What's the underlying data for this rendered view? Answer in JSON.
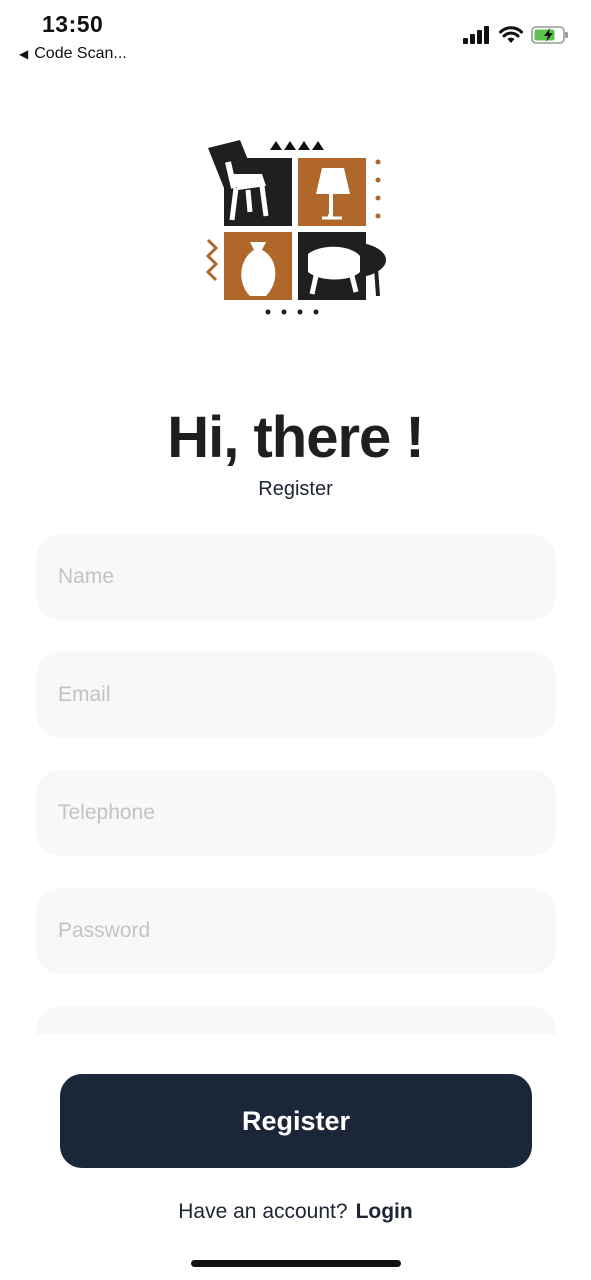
{
  "status_bar": {
    "time": "13:50",
    "back_label": "Code Scan...",
    "icons": [
      "back-arrow-icon",
      "signal-icon",
      "wifi-icon",
      "battery-charging-icon"
    ]
  },
  "header": {
    "title": "Hi, there !",
    "subtitle": "Register"
  },
  "form": {
    "fields": [
      {
        "placeholder": "Name",
        "value": ""
      },
      {
        "placeholder": "Email",
        "value": ""
      },
      {
        "placeholder": "Telephone",
        "value": ""
      },
      {
        "placeholder": "Password",
        "value": ""
      },
      {
        "placeholder": "",
        "value": ""
      }
    ]
  },
  "actions": {
    "register_label": "Register"
  },
  "footer": {
    "prompt": "Have an account?",
    "login_label": "Login"
  },
  "colors": {
    "brand_brown": "#b0682a",
    "dark": "#1b2638",
    "field_bg": "#f8f8f9"
  }
}
